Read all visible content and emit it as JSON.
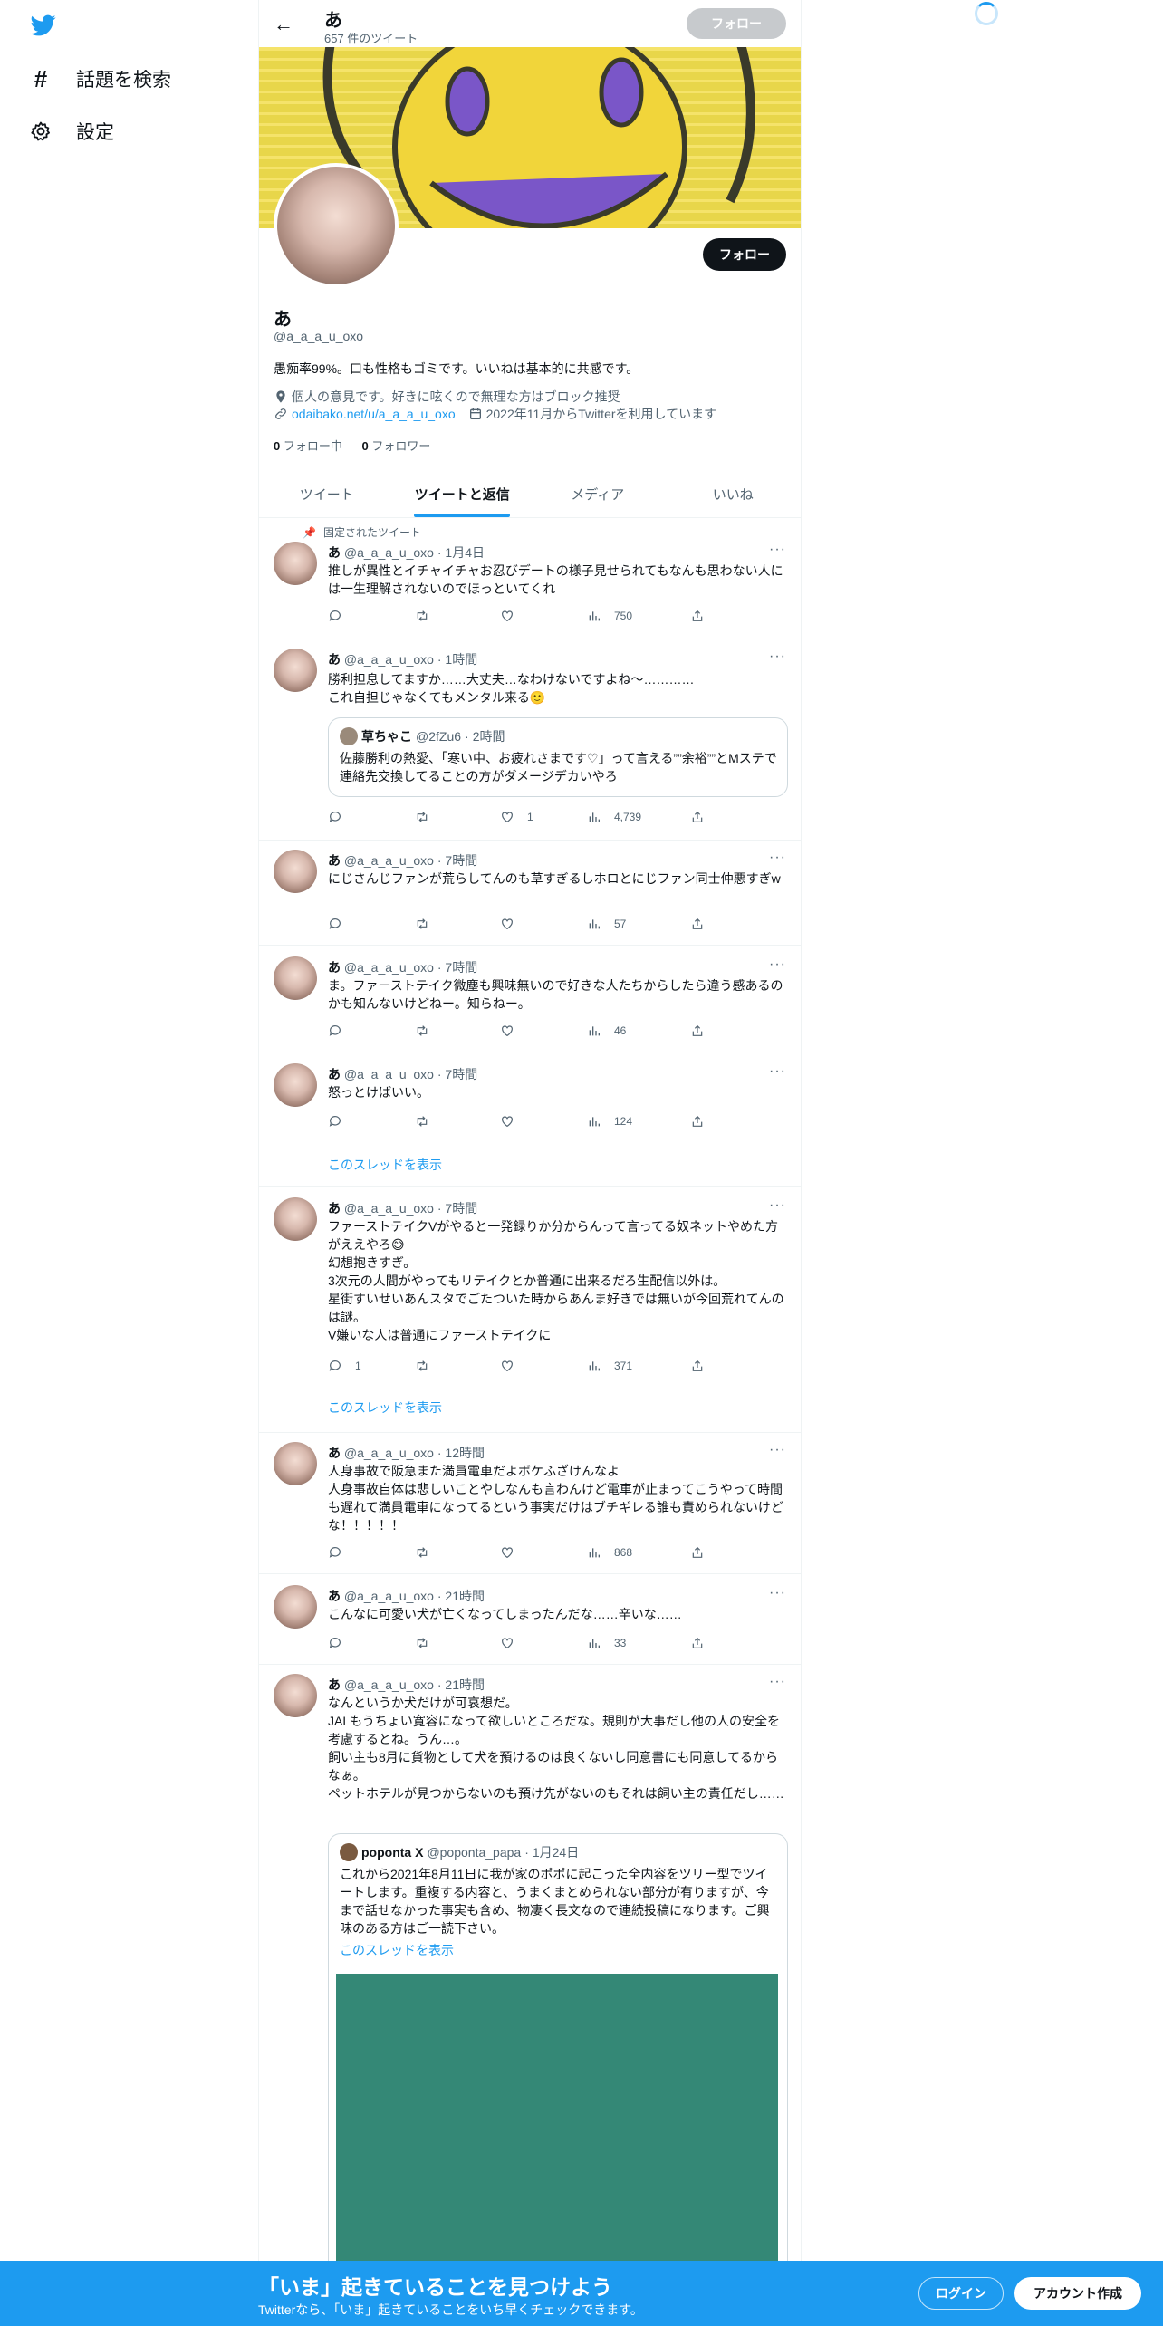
{
  "nav": {
    "logo_icon": "twitter-bird-icon",
    "items": [
      {
        "icon": "hashtag-icon",
        "label": "話題を検索"
      },
      {
        "icon": "gear-icon",
        "label": "設定"
      }
    ]
  },
  "header": {
    "name": "あ",
    "tweet_count": "657 件のツイート",
    "follow_label": "フォロー"
  },
  "profile": {
    "follow_label": "フォロー",
    "name": "あ",
    "handle": "@a_a_a_u_oxo",
    "bio": "愚痴率99%。口も性格もゴミです。いいねは基本的に共感です。",
    "location": "個人の意見です。好きに呟くので無理な方はブロック推奨",
    "link": "odaibako.net/u/a_a_a_u_oxo",
    "joined": "2022年11月からTwitterを利用しています",
    "following_count": "0",
    "following_label": "フォロー中",
    "followers_count": "0",
    "followers_label": "フォロワー"
  },
  "tabs": [
    {
      "label": "ツイート"
    },
    {
      "label": "ツイートと返信"
    },
    {
      "label": "メディア"
    },
    {
      "label": "いいね"
    }
  ],
  "pinned_label": "固定されたツイート",
  "thread_label": "このスレッドを表示",
  "tweets": [
    {
      "name": "あ",
      "handle": "@a_a_a_u_oxo",
      "time": "1月4日",
      "text": "推しが異性とイチャイチャお忍びデートの様子見せられてもなんも思わない人には一生理解されないのでほっといてくれ",
      "replies": "",
      "likes": "",
      "views": "750"
    },
    {
      "name": "あ",
      "handle": "@a_a_a_u_oxo",
      "time": "1時間",
      "text": "勝利担息してますか……大丈夫…なわけないですよね〜…………\nこれ自担じゃなくてもメンタル来る🙂",
      "replies": "",
      "likes": "1",
      "views": "4,739",
      "quote": {
        "name": "草ちゃこ",
        "handle": "@2fZu6",
        "time": "2時間",
        "text": "佐藤勝利の熱愛、「寒い中、お疲れさまです♡」って言える””余裕””とMステで連絡先交換してることの方がダメージデカいやろ"
      }
    },
    {
      "name": "あ",
      "handle": "@a_a_a_u_oxo",
      "time": "7時間",
      "text": "にじさんじファンが荒らしてんのも草すぎるしホロとにじファン同士仲悪すぎw",
      "replies": "",
      "likes": "",
      "views": "57"
    },
    {
      "name": "あ",
      "handle": "@a_a_a_u_oxo",
      "time": "7時間",
      "text": "ま。ファーストテイク微塵も興味無いので好きな人たちからしたら違う感あるのかも知んないけどねー。知らねー。",
      "replies": "",
      "likes": "",
      "views": "46"
    },
    {
      "name": "あ",
      "handle": "@a_a_a_u_oxo",
      "time": "7時間",
      "text": "怒っとけばいい。",
      "replies": "",
      "likes": "",
      "views": "124"
    },
    {
      "name": "あ",
      "handle": "@a_a_a_u_oxo",
      "time": "7時間",
      "text": "ファーストテイクVがやると一発録りか分からんって言ってる奴ネットやめた方がええやろ😅\n幻想抱きすぎ。\n3次元の人間がやってもリテイクとか普通に出来るだろ生配信以外は。\n星街すいせいあんスタでごたついた時からあんま好きでは無いが今回荒れてんのは謎。\nV嫌いな人は普通にファーストテイクに",
      "replies": "1",
      "likes": "",
      "views": "371"
    },
    {
      "name": "あ",
      "handle": "@a_a_a_u_oxo",
      "time": "12時間",
      "text": "人身事故で阪急また満員電車だよボケふざけんなよ\n人身事故自体は悲しいことやしなんも言わんけど電車が止まってこうやって時間も遅れて満員電車になってるという事実だけはブチギレる誰も責められないけどな！！！！！",
      "replies": "",
      "likes": "",
      "views": "868"
    },
    {
      "name": "あ",
      "handle": "@a_a_a_u_oxo",
      "time": "21時間",
      "text": "こんなに可愛い犬が亡くなってしまったんだな……辛いな……",
      "replies": "",
      "likes": "",
      "views": "33"
    },
    {
      "name": "あ",
      "handle": "@a_a_a_u_oxo",
      "time": "21時間",
      "text": "なんというか犬だけが可哀想だ。\nJALもうちょい寛容になって欲しいところだな。規則が大事だし他の人の安全を考慮するとね。うん…。\n飼い主も8月に貨物として犬を預けるのは良くないし同意書にも同意してるからなぁ。\nペットホテルが見つからないのも預け先がないのもそれは飼い主の責任だし……",
      "quote": {
        "name": "poponta X",
        "handle": "@poponta_papa",
        "time": "1月24日",
        "text": "これから2021年8月11日に我が家のポポに起こった全内容をツリー型でツイートします。重複する内容と、うまくまとめられない部分が有りますが、今まで話せなかった事実も含め、物凄く長文なので連続投稿になります。ご興味のある方はご一読下さい。"
      }
    }
  ],
  "bottom": {
    "title": "「いま」起きていることを見つけよう",
    "subtitle": "Twitterなら、「いま」起きていることをいち早くチェックできます。",
    "login": "ログイン",
    "signup": "アカウント作成"
  },
  "colors": {
    "accent": "#1d9bf0",
    "banner": "#e7d349",
    "quote_image": "#348876"
  }
}
